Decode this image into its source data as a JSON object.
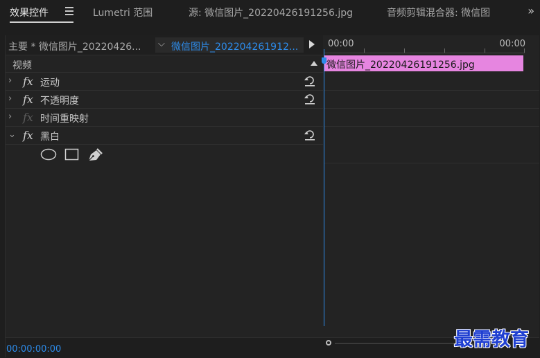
{
  "tabs": [
    {
      "label": "效果控件"
    },
    {
      "label": "Lumetri 范围"
    },
    {
      "label": "源: 微信图片_20220426191256.jpg"
    },
    {
      "label": "音频剪辑混合器: 微信图"
    }
  ],
  "overflow_icon": "double-chevron-right-icon",
  "panel": {
    "master_label": "主要 * 微信图片_20220426...",
    "clip_selector": "微信图片_202204261912...",
    "video_label": "视频",
    "effects": [
      {
        "label": "运动",
        "fx_enabled": true,
        "reset": true,
        "expanded": false
      },
      {
        "label": "不透明度",
        "fx_enabled": true,
        "reset": true,
        "expanded": false
      },
      {
        "label": "时间重映射",
        "fx_enabled": false,
        "reset": false,
        "expanded": false
      },
      {
        "label": "黑白",
        "fx_enabled": true,
        "reset": true,
        "expanded": true
      }
    ],
    "fx_symbol": "fx",
    "mask_tools": [
      "ellipse-mask-icon",
      "rectangle-mask-icon",
      "pen-mask-icon"
    ]
  },
  "timeline": {
    "tc_start": "00:00",
    "tc_end": "00:00",
    "clip_name": "微信图片_20220426191256.jpg",
    "clip_color": "#e685e0"
  },
  "footer": {
    "timecode": "00:00:00:00"
  },
  "watermark": "最需教育",
  "colors": {
    "accent": "#2d8ceb",
    "background": "#232323"
  }
}
